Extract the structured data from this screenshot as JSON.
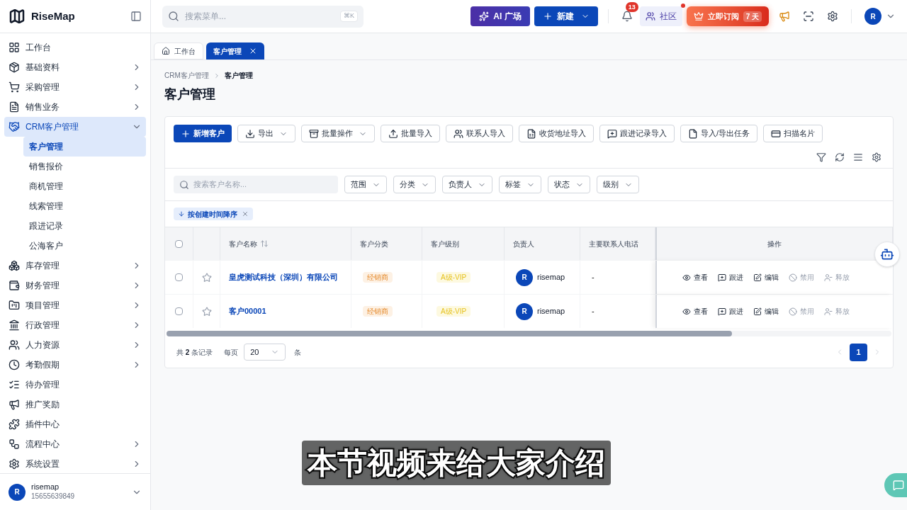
{
  "brand": {
    "name": "RiseMap"
  },
  "sidebar": {
    "items": [
      {
        "label": "工作台",
        "chevron": false,
        "selected": false
      },
      {
        "label": "基础资料",
        "chevron": true,
        "expanded": false,
        "selected": false
      },
      {
        "label": "采购管理",
        "chevron": true,
        "expanded": false,
        "selected": false
      },
      {
        "label": "销售业务",
        "chevron": true,
        "expanded": false,
        "selected": false
      },
      {
        "label": "CRM客户管理",
        "chevron": true,
        "expanded": true,
        "selected": true,
        "children": [
          {
            "label": "客户管理",
            "selected": true
          },
          {
            "label": "销售报价",
            "selected": false
          },
          {
            "label": "商机管理",
            "selected": false
          },
          {
            "label": "线索管理",
            "selected": false
          },
          {
            "label": "跟进记录",
            "selected": false
          },
          {
            "label": "公海客户",
            "selected": false
          }
        ]
      },
      {
        "label": "库存管理",
        "chevron": true,
        "expanded": false,
        "selected": false
      },
      {
        "label": "财务管理",
        "chevron": true,
        "expanded": false,
        "selected": false
      },
      {
        "label": "项目管理",
        "chevron": true,
        "expanded": false,
        "selected": false
      },
      {
        "label": "行政管理",
        "chevron": true,
        "expanded": false,
        "selected": false
      },
      {
        "label": "人力资源",
        "chevron": true,
        "expanded": false,
        "selected": false
      },
      {
        "label": "考勤假期",
        "chevron": true,
        "expanded": false,
        "selected": false
      },
      {
        "label": "待办管理",
        "chevron": false,
        "selected": false
      },
      {
        "label": "推广奖励",
        "chevron": false,
        "selected": false
      },
      {
        "label": "插件中心",
        "chevron": false,
        "selected": false
      },
      {
        "label": "流程中心",
        "chevron": true,
        "expanded": false,
        "selected": false
      },
      {
        "label": "系统设置",
        "chevron": true,
        "expanded": false,
        "selected": false
      }
    ],
    "user": {
      "avatar": "R",
      "name": "risemap",
      "phone": "15655639849"
    }
  },
  "topbar": {
    "search": {
      "placeholder": "搜索菜单...",
      "shortcut": "⌘K"
    },
    "ai_button": "AI 广场",
    "new_button": "新建",
    "notifications": "13",
    "community": {
      "label": "社区",
      "dot": true
    },
    "subscribe": {
      "label": "立即订阅",
      "days": "7 天"
    },
    "avatar": "R"
  },
  "tabs": [
    {
      "label": "工作台",
      "selected": false,
      "closable": false
    },
    {
      "label": "客户管理",
      "selected": true,
      "closable": true
    }
  ],
  "breadcrumb": [
    "CRM客户管理",
    "客户管理"
  ],
  "page_title": "客户管理",
  "toolbar": [
    {
      "label": "新增客户",
      "kind": "primary",
      "dropdown": false
    },
    {
      "label": "导出",
      "kind": "default",
      "dropdown": true
    },
    {
      "label": "批量操作",
      "kind": "default",
      "dropdown": true
    },
    {
      "label": "批量导入",
      "kind": "default",
      "dropdown": false
    },
    {
      "label": "联系人导入",
      "kind": "default",
      "dropdown": false
    },
    {
      "label": "收货地址导入",
      "kind": "default",
      "dropdown": false
    },
    {
      "label": "跟进记录导入",
      "kind": "default",
      "dropdown": false
    },
    {
      "label": "导入/导出任务",
      "kind": "default",
      "dropdown": false
    },
    {
      "label": "扫描名片",
      "kind": "default",
      "dropdown": false
    }
  ],
  "filters": {
    "search_placeholder": "搜索客户名称...",
    "dropdowns": [
      "范围",
      "分类",
      "负责人",
      "标签",
      "状态",
      "级别"
    ],
    "sort_tag": "按创建时间降序"
  },
  "table": {
    "columns": [
      "客户名称",
      "客户分类",
      "客户级别",
      "负责人",
      "主要联系人电话",
      "操作"
    ],
    "rows": [
      {
        "checked": false,
        "starred": false,
        "name": "皇虎测试科技（深圳）有限公司",
        "category": "经销商",
        "level": "A级-VIP",
        "owner_avatar": "R",
        "owner": "risemap",
        "phone": "-",
        "actions": [
          {
            "label": "查看",
            "disabled": false
          },
          {
            "label": "跟进",
            "disabled": false
          },
          {
            "label": "编辑",
            "disabled": false
          },
          {
            "label": "禁用",
            "disabled": true
          },
          {
            "label": "释放",
            "disabled": true
          }
        ]
      },
      {
        "checked": false,
        "starred": false,
        "name": "客户00001",
        "category": "经销商",
        "level": "A级-VIP",
        "owner_avatar": "R",
        "owner": "risemap",
        "phone": "-",
        "actions": [
          {
            "label": "查看",
            "disabled": false
          },
          {
            "label": "跟进",
            "disabled": false
          },
          {
            "label": "编辑",
            "disabled": false
          },
          {
            "label": "禁用",
            "disabled": true
          },
          {
            "label": "释放",
            "disabled": true
          }
        ]
      }
    ],
    "all_checked": false
  },
  "pagination": {
    "total_prefix": "共",
    "total": "2",
    "total_suffix": "条记录",
    "per_page_label": "每页",
    "per_page": "20",
    "unit": "条",
    "pages": [
      {
        "label": "1",
        "selected": true
      }
    ]
  },
  "caption": "本节视频来给大家介绍"
}
